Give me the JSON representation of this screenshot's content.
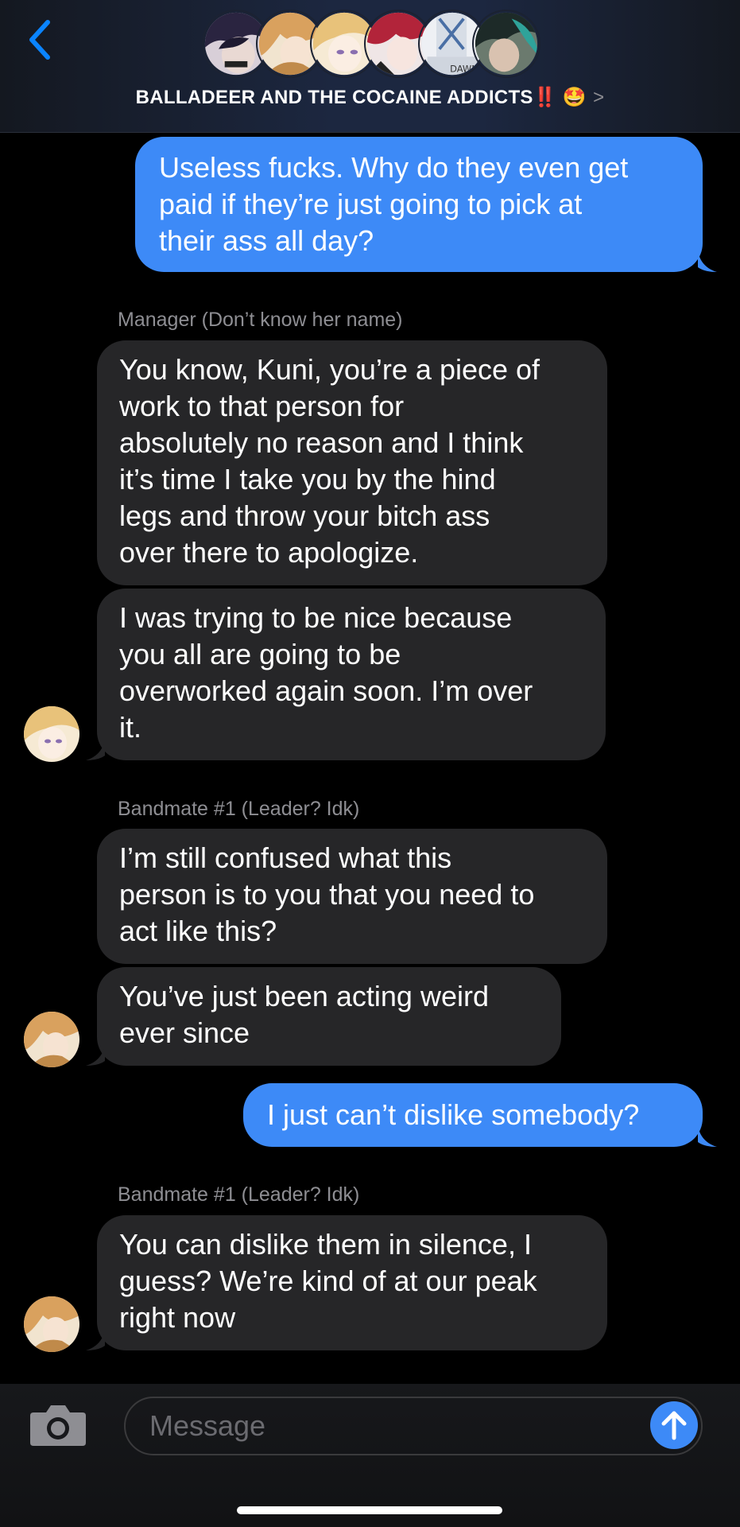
{
  "header": {
    "title": "BALLADEER AND THE COCAINE ADDICTS",
    "title_emojis": "‼️ 🤩",
    "chevron": ">",
    "avatar_badge_text": "DAWN",
    "back_icon": "chevron-left-icon",
    "accent_color": "#0a84ff"
  },
  "messages": [
    {
      "type": "sent",
      "lines": [
        "Useless fucks. Why do they even get",
        "paid if they’re just going to pick at",
        "their ass all day?"
      ]
    },
    {
      "type": "sender_label",
      "text": "Manager (Don’t know her name)"
    },
    {
      "type": "received",
      "lines": [
        "You know, Kuni, you’re a piece of",
        "work to that person for",
        "absolutely no reason and I think",
        "it’s time I take you by the hind",
        "legs and throw your bitch ass",
        "over there to apologize."
      ]
    },
    {
      "type": "received",
      "lines": [
        "I was trying to be nice because",
        "you all are going to be",
        "overworked again soon. I’m over",
        "it."
      ]
    },
    {
      "type": "sender_label",
      "text": "Bandmate #1 (Leader? Idk)"
    },
    {
      "type": "received",
      "lines": [
        "I’m still confused what this",
        "person is to you that you need to",
        "act like this?"
      ]
    },
    {
      "type": "received",
      "lines": [
        "You’ve just been acting weird",
        "ever since"
      ]
    },
    {
      "type": "sent",
      "lines": [
        "I just can’t dislike somebody?"
      ]
    },
    {
      "type": "sender_label",
      "text": "Bandmate #1 (Leader? Idk)"
    },
    {
      "type": "received",
      "lines": [
        "You can dislike them in silence, I",
        "guess? We’re kind of at our peak",
        "right now"
      ]
    }
  ],
  "input": {
    "placeholder": "Message",
    "camera_icon": "camera-icon",
    "send_icon": "arrow-up-icon"
  },
  "colors": {
    "sent_bubble": "#3d8af7",
    "received_bubble": "#262628",
    "background": "#000000",
    "secondary_text": "#8e8e93"
  }
}
